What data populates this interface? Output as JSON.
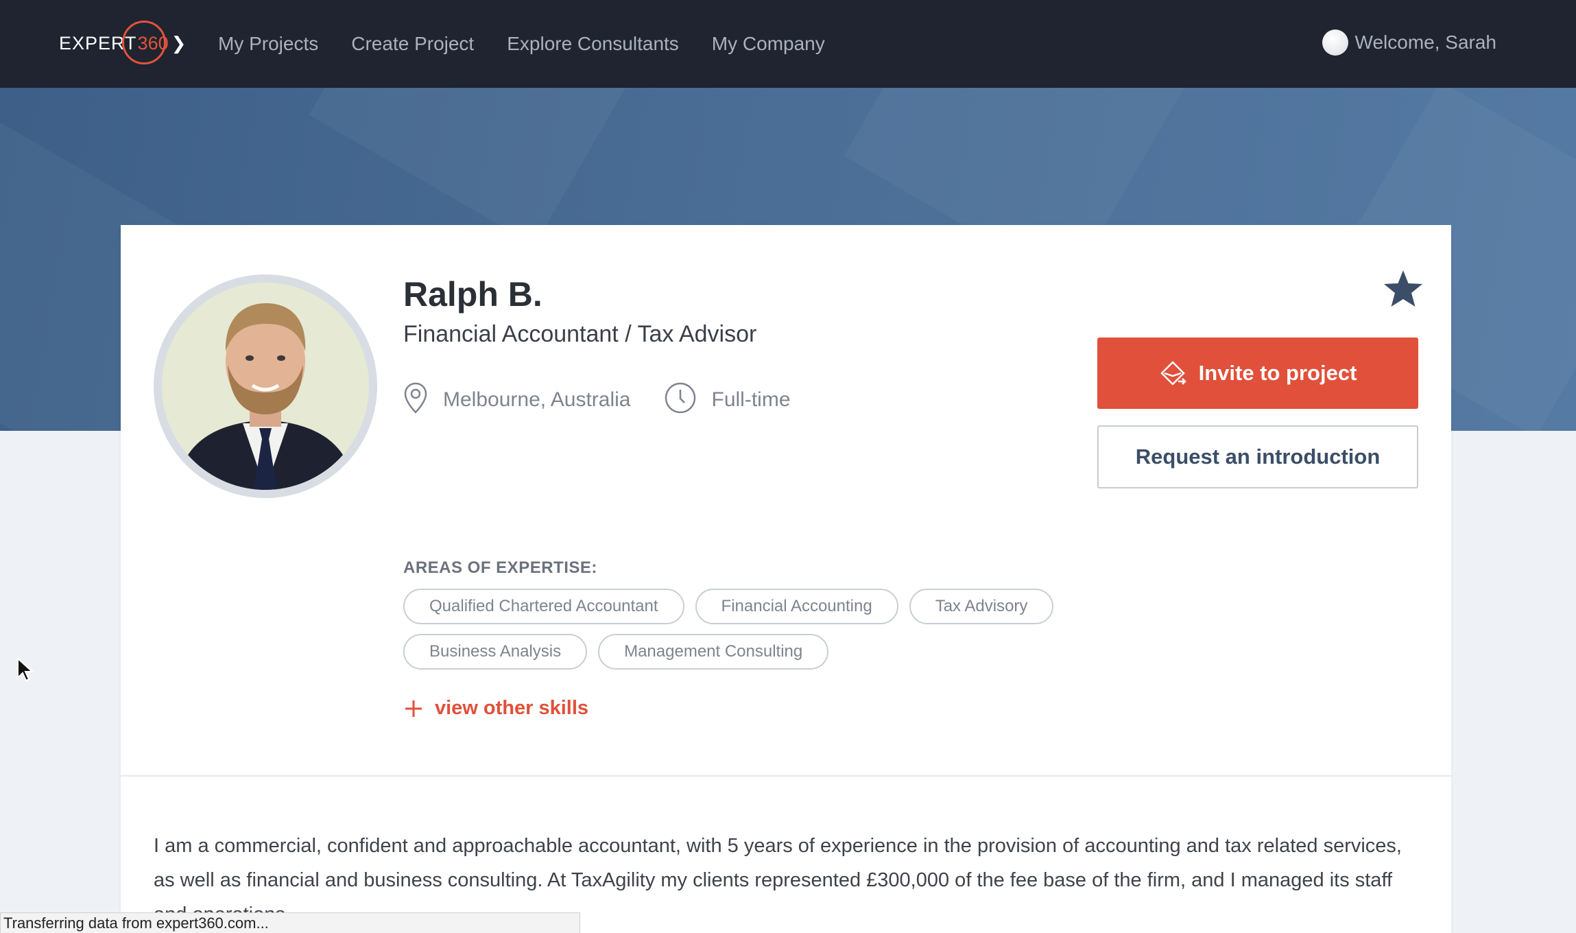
{
  "header": {
    "logo": {
      "word": "EXPERT",
      "number": "360",
      "chevron": "❯"
    },
    "nav": [
      {
        "label": "My Projects"
      },
      {
        "label": "Create Project"
      },
      {
        "label": "Explore Consultants"
      },
      {
        "label": "My Company"
      }
    ],
    "welcome": "Welcome, Sarah",
    "avatar_icon": "user-avatar"
  },
  "profile": {
    "name": "Ralph B.",
    "title": "Financial Accountant / Tax Advisor",
    "location": "Melbourne, Australia",
    "location_icon": "map-pin-icon",
    "availability": "Full-time",
    "availability_icon": "clock-icon",
    "favorite_icon": "star-icon"
  },
  "actions": {
    "invite_label": "Invite to project",
    "invite_icon": "envelope-send-icon",
    "intro_label": "Request an introduction"
  },
  "expertise": {
    "heading": "AREAS OF EXPERTISE:",
    "tags": [
      "Qualified Chartered Accountant",
      "Financial Accounting",
      "Tax Advisory",
      "Business Analysis",
      "Management Consulting"
    ],
    "view_more_label": "view other skills"
  },
  "bio": {
    "text": "I am a commercial, confident and approachable accountant, with 5 years of experience in the provision of accounting and tax related services, as well as financial and business consulting. At TaxAgility my clients represented £300,000 of the fee base of the firm, and I managed its staff and operations."
  },
  "browser_status": "Transferring data from expert360.com...",
  "colors": {
    "nav_bg": "#1f2430",
    "hero_bg": "#4a6d95",
    "accent": "#e0503a",
    "secondary_button_text": "#3b4e68",
    "star": "#3b4e68"
  }
}
